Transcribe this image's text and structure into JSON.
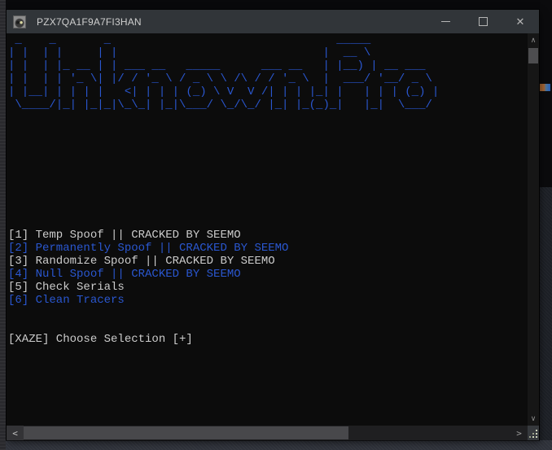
{
  "window": {
    "title": "PZX7QA1F9A7FI3HAN"
  },
  "icons": {
    "app_icon": "hooded-avatar",
    "minimize": "—",
    "maximize": "□",
    "close": "✕",
    "scroll_up": "∧",
    "scroll_down": "∨",
    "scroll_left": "<",
    "scroll_right": ">"
  },
  "palette": {
    "console_background": "#0c0c0c",
    "console_text": "#cccccc",
    "console_blue": "#2a57d0",
    "titlebar_background": "#313539",
    "titlebar_text": "#cfcfcf"
  },
  "console": {
    "ascii_art_text": "Unknown.Pro",
    "ascii_art_lines": [
      " _    _       _                                 _____",
      "| |  | |     | |                              |  __ \\",
      "| |  | |_ __ | | ___ __   _____      ___ __   | |__) | __ ___",
      "| |  | | '_ \\| |/ / '_ \\ / _ \\ \\ /\\ / / '_ \\  |  ___/ '__/ _ \\",
      "| |__| | | | |   <| | | | (_) \\ V  V /| | | |_| |   | | | (_) |",
      " \\____/|_| |_|_|\\_\\_| |_|\\___/ \\_/\\_/ |_| |_(_)_|   |_|  \\___/"
    ],
    "blank_lines_after_art": 9,
    "menu_items": [
      {
        "label": "[1] Temp Spoof || CRACKED BY SEEMO",
        "color": "white"
      },
      {
        "label": "[2] Permanently Spoof || CRACKED BY SEEMO",
        "color": "blue"
      },
      {
        "label": "[3] Randomize Spoof || CRACKED BY SEEMO",
        "color": "white"
      },
      {
        "label": "[4] Null Spoof || CRACKED BY SEEMO",
        "color": "blue"
      },
      {
        "label": "[5] Check Serials",
        "color": "white"
      },
      {
        "label": "[6] Clean Tracers",
        "color": "blue"
      }
    ],
    "blank_lines_after_menu": 2,
    "prompt": "[XAZE] Choose Selection [+]"
  }
}
